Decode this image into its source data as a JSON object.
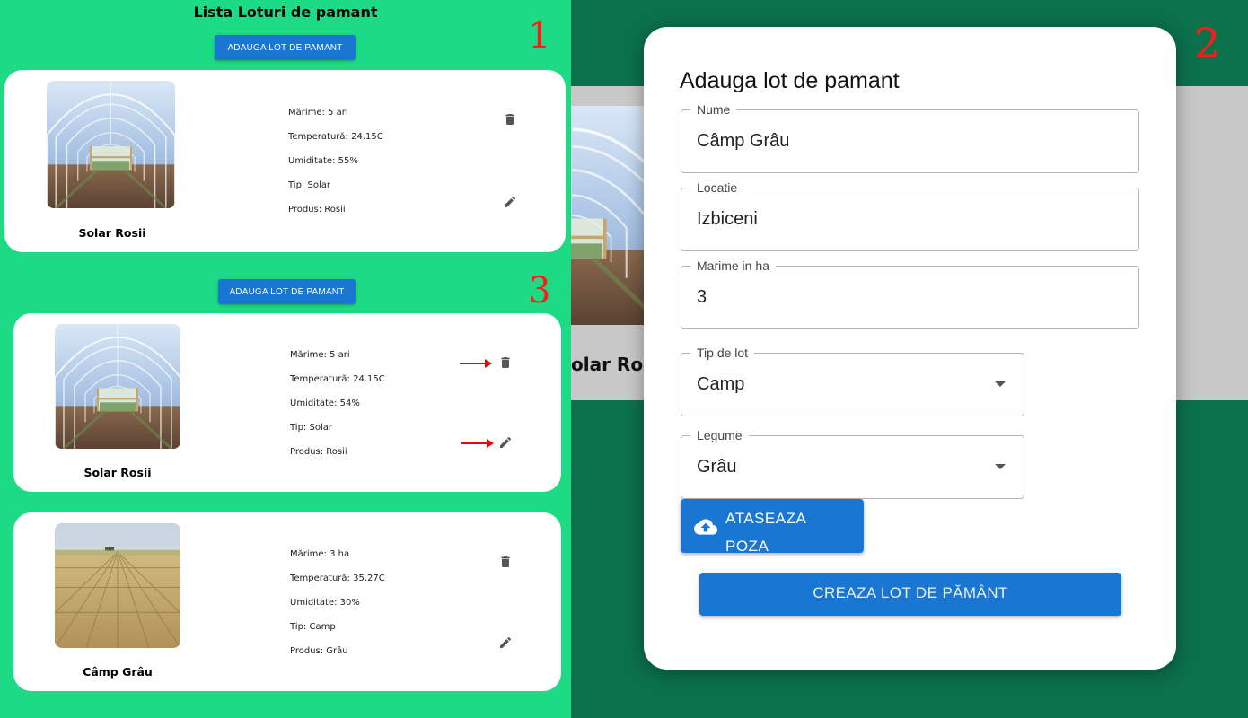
{
  "markers": {
    "one": "1",
    "two": "2",
    "three": "3"
  },
  "list": {
    "title": "Lista Loturi de pamant",
    "add_button_label": "ADAUGA LOT DE PAMANT"
  },
  "card_top": {
    "name": "Solar Rosii",
    "size": "Mărime: 5 ari",
    "temperature": "Temperatură: 24.15C",
    "humidity": "Umiditate: 55%",
    "type": "Tip: Solar",
    "product": "Produs: Rosii",
    "photo_icon": "greenhouse-photo"
  },
  "section3": {
    "add_button_label": "ADAUGA LOT DE PAMANT",
    "cards": [
      {
        "name": "Solar Rosii",
        "size": "Mărime: 5 ari",
        "temperature": "Temperatură: 24.15C",
        "humidity": "Umiditate: 54%",
        "type": "Tip: Solar",
        "product": "Produs: Rosii",
        "photo_icon": "greenhouse-photo"
      },
      {
        "name": "Câmp Grâu",
        "size": "Mărime: 3 ha",
        "temperature": "Temperatură: 35.27C",
        "humidity": "Umiditate: 30%",
        "type": "Tip: Camp",
        "product": "Produs: Grâu",
        "photo_icon": "wheat-field-photo"
      }
    ]
  },
  "background": {
    "card_text": "olar Ro"
  },
  "dialog": {
    "title": "Adauga lot de pamant",
    "fields": {
      "nume": {
        "label": "Nume",
        "value": "Câmp Grâu"
      },
      "locatie": {
        "label": "Locatie",
        "value": "Izbiceni"
      },
      "marime": {
        "label": "Marime in ha",
        "value": "3"
      },
      "tip": {
        "label": "Tip de lot",
        "value": "Camp"
      },
      "legume": {
        "label": "Legume",
        "value": "Grâu"
      }
    },
    "upload_button": {
      "line1": "ATASEAZA",
      "line2": "POZA",
      "icon": "cloud-upload-icon"
    },
    "create_button": "CREAZA LOT DE PĂMÂNT"
  },
  "colors": {
    "left_bg": "#1ddb85",
    "right_bg": "#0b714a",
    "primary": "#1976d2",
    "marker": "#ff1a1a"
  }
}
